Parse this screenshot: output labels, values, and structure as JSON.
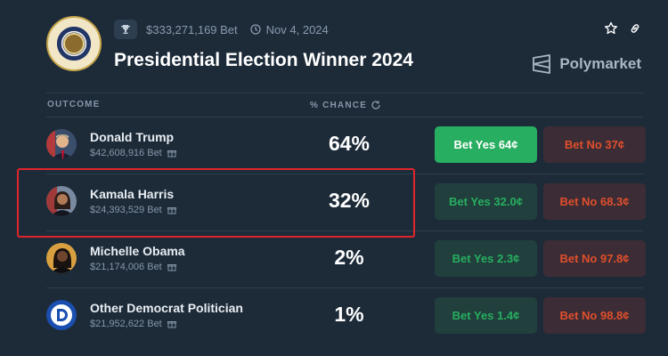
{
  "header": {
    "volume": "$333,271,169 Bet",
    "date": "Nov 4, 2024",
    "title": "Presidential Election Winner 2024",
    "brand": "Polymarket"
  },
  "columns": {
    "outcome": "OUTCOME",
    "chance": "% CHANCE"
  },
  "outcomes": [
    {
      "name": "Donald Trump",
      "bet": "$42,608,916 Bet",
      "chance": "64%",
      "yes": "Bet Yes 64¢",
      "no": "Bet No 37¢"
    },
    {
      "name": "Kamala Harris",
      "bet": "$24,393,529 Bet",
      "chance": "32%",
      "yes": "Bet Yes 32.0¢",
      "no": "Bet No 68.3¢"
    },
    {
      "name": "Michelle Obama",
      "bet": "$21,174,006 Bet",
      "chance": "2%",
      "yes": "Bet Yes 2.3¢",
      "no": "Bet No 97.8¢"
    },
    {
      "name": "Other Democrat Politician",
      "bet": "$21,952,622 Bet",
      "chance": "1%",
      "yes": "Bet Yes 1.4¢",
      "no": "Bet No 98.8¢"
    }
  ],
  "colors": {
    "background": "#1d2b39",
    "yes": "#27ae60",
    "no": "#e04f2c",
    "highlight": "#e0242c"
  }
}
